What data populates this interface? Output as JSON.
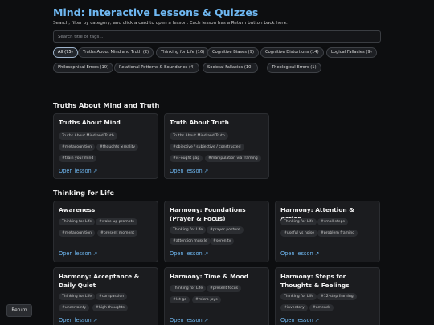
{
  "header": {
    "title": "Mind: Interactive Lessons & Quizzes",
    "subtitle": "Search, filter by category, and click a card to open a lesson. Each lesson has a Return button back here."
  },
  "search": {
    "placeholder": "Search title or tags...",
    "value": ""
  },
  "filters": [
    "All (75)",
    "Truths About Mind and Truth (2)",
    "Thinking for Life (16)",
    "Cognitive Biases (9)",
    "Cognitive Distortions (14)",
    "Logical Fallacies (9)",
    "Philosophical Errors (10)",
    "Relational Patterns & Boundaries (4)",
    "Societal Fallacies (10)",
    "Theological Errors (1)"
  ],
  "active_filter": "All (75)",
  "sections": [
    {
      "title": "Truths About Mind and Truth",
      "cards": [
        {
          "title": "Truths About Mind",
          "tags": [
            "Truths About Mind and Truth",
            "#metacognition",
            "#thoughts ≠reality",
            "#train your mind"
          ],
          "link": "Open lesson ↗"
        },
        {
          "title": "Truth About Truth",
          "tags": [
            "Truths About Mind and Truth",
            "#objective / subjective / constructed",
            "#is–ought gap",
            "#manipulation via framing"
          ],
          "link": "Open lesson ↗"
        }
      ]
    },
    {
      "title": "Thinking for Life",
      "cards": [
        {
          "title": "Awareness",
          "tags": [
            "Thinking for Life",
            "#wake-up prompts",
            "#metacognition",
            "#present moment"
          ],
          "link": "Open lesson ↗"
        },
        {
          "title": "Harmony: Foundations (Prayer & Focus)",
          "tags": [
            "Thinking for Life",
            "#prayer posture",
            "#attention muscle",
            "#serenity"
          ],
          "link": "Open lesson ↗"
        },
        {
          "title": "Harmony: Attention & Action",
          "tags": [
            "Thinking for Life",
            "#small steps",
            "#useful vs noise",
            "#problem framing"
          ],
          "link": "Open lesson ↗"
        },
        {
          "title": "Harmony: Acceptance & Daily Quiet",
          "tags": [
            "Thinking for Life",
            "#compassion",
            "#uncertainty",
            "#high thoughts"
          ],
          "link": "Open lesson ↗"
        },
        {
          "title": "Harmony: Time & Mood",
          "tags": [
            "Thinking for Life",
            "#present focus",
            "#let go",
            "#micro-joys"
          ],
          "link": "Open lesson ↗"
        },
        {
          "title": "Harmony: Steps for Thoughts & Feelings",
          "tags": [
            "Thinking for Life",
            "#12-step framing",
            "#inventory",
            "#amends"
          ],
          "link": "Open lesson ↗"
        }
      ]
    }
  ],
  "return_label": "Return"
}
